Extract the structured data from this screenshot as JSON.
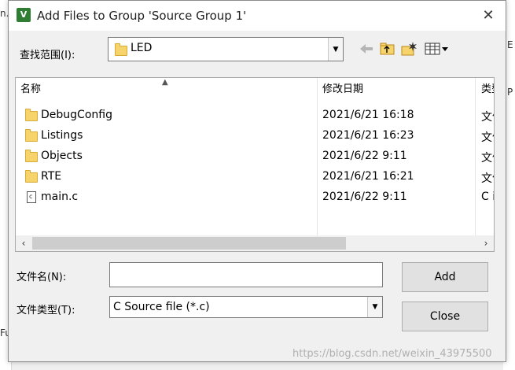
{
  "background": {
    "left_fragment": "n.",
    "bottom_fragment": "Fu",
    "right_fragment_1": "E",
    "right_fragment_2": "P",
    "right_fragment_3": ""
  },
  "dialog": {
    "title": "Add Files to Group 'Source Group 1'",
    "close_glyph": "✕",
    "look_in": {
      "label": "查找范围(I):",
      "value": "LED"
    },
    "toolbar_icons": [
      "back-arrow-icon",
      "up-folder-icon",
      "new-folder-icon",
      "view-menu-icon"
    ],
    "columns": {
      "name": "名称",
      "date": "修改日期",
      "type": "类型"
    },
    "files": [
      {
        "icon": "folder",
        "name": "DebugConfig",
        "date": "2021/6/21 16:18",
        "type": "文件"
      },
      {
        "icon": "folder",
        "name": "Listings",
        "date": "2021/6/21 16:23",
        "type": "文件"
      },
      {
        "icon": "folder",
        "name": "Objects",
        "date": "2021/6/22 9:11",
        "type": "文件"
      },
      {
        "icon": "folder",
        "name": "RTE",
        "date": "2021/6/21 16:21",
        "type": "文件"
      },
      {
        "icon": "c-file",
        "name": "main.c",
        "date": "2021/6/22 9:11",
        "type": "C i"
      }
    ],
    "filename": {
      "label": "文件名(N):",
      "value": ""
    },
    "filetype": {
      "label": "文件类型(T):",
      "value": "C Source file (*.c)"
    },
    "buttons": {
      "add": "Add",
      "close": "Close"
    }
  },
  "watermark": "https://blog.csdn.net/weixin_43975500",
  "colors": {
    "folder": "#f7d46b",
    "scroll_thumb": "#cdcdcd",
    "button_face": "#e1e1e1"
  }
}
